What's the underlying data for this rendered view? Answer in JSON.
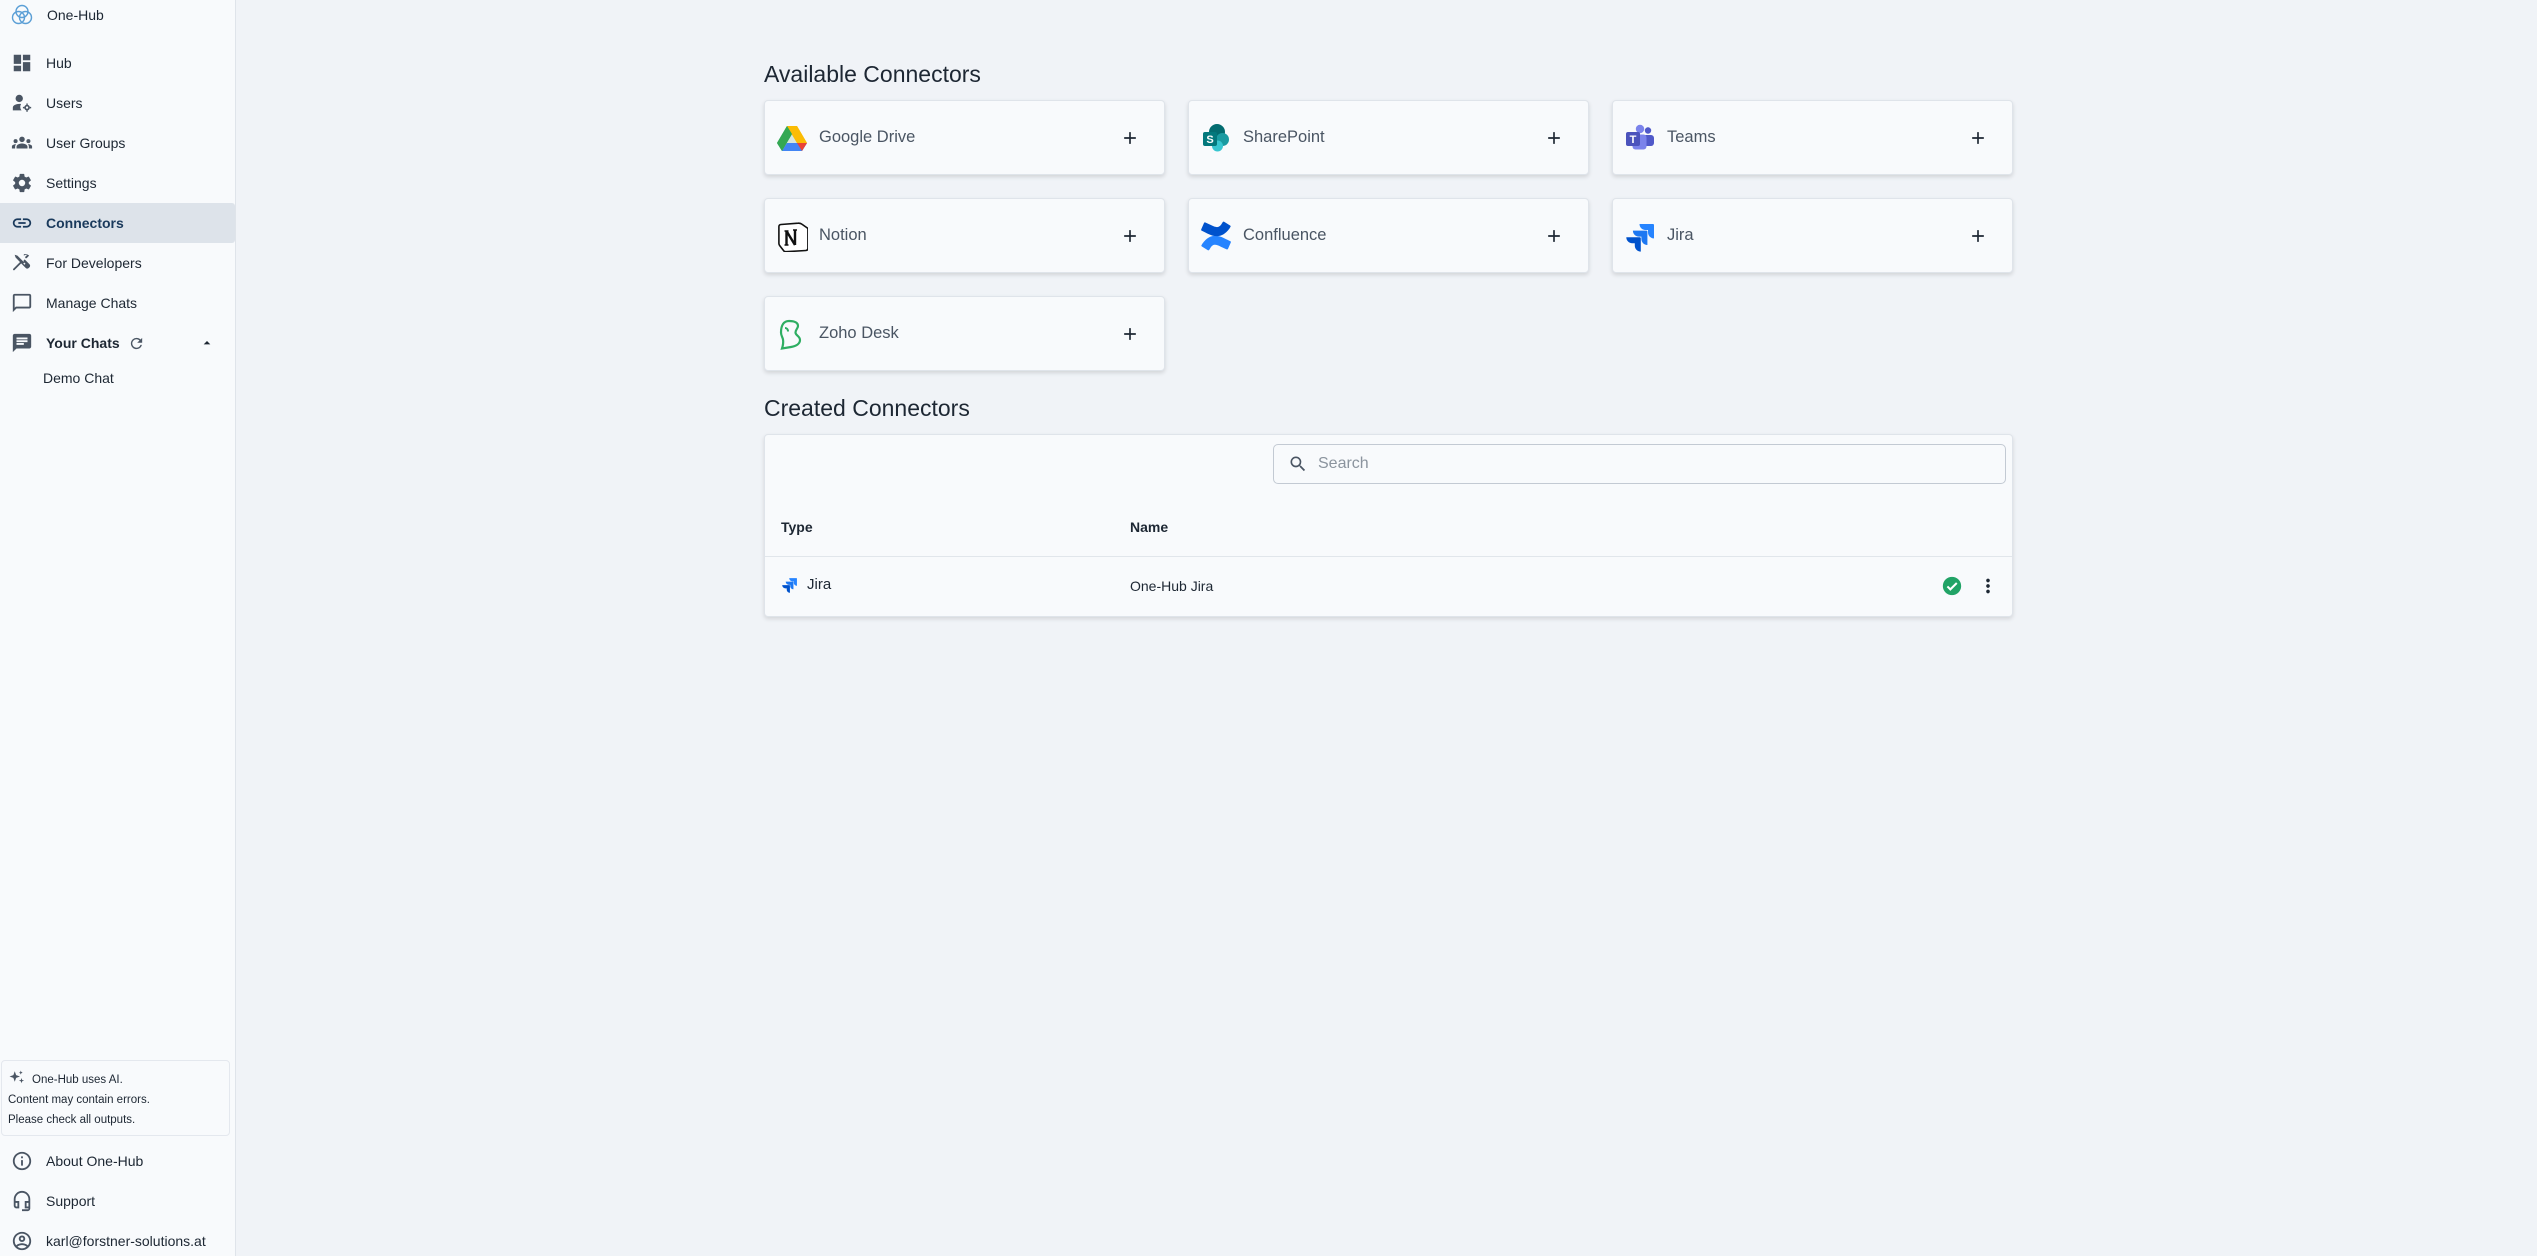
{
  "app": {
    "name": "One-Hub"
  },
  "sidebar": {
    "items": [
      {
        "label": "Hub",
        "icon": "dashboard-icon"
      },
      {
        "label": "Users",
        "icon": "user-settings-icon"
      },
      {
        "label": "User Groups",
        "icon": "groups-icon"
      },
      {
        "label": "Settings",
        "icon": "gear-icon"
      },
      {
        "label": "Connectors",
        "icon": "link-icon",
        "active": true
      },
      {
        "label": "For Developers",
        "icon": "developer-tools-icon"
      },
      {
        "label": "Manage Chats",
        "icon": "chat-bubble-icon"
      }
    ],
    "your_chats": {
      "label": "Your Chats",
      "chats": [
        "Demo Chat"
      ]
    },
    "notice": {
      "line1": "One-Hub uses AI.",
      "line2": "Content may contain errors.",
      "line3": "Please check all outputs."
    },
    "bottom": [
      {
        "label": "About One-Hub",
        "icon": "info-icon"
      },
      {
        "label": "Support",
        "icon": "headset-icon"
      },
      {
        "label": "karl@forstner-solutions.at",
        "icon": "account-icon"
      }
    ]
  },
  "available": {
    "title": "Available Connectors",
    "connectors": [
      {
        "name": "Google Drive",
        "icon": "google-drive-icon"
      },
      {
        "name": "SharePoint",
        "icon": "sharepoint-icon"
      },
      {
        "name": "Teams",
        "icon": "teams-icon"
      },
      {
        "name": "Notion",
        "icon": "notion-icon"
      },
      {
        "name": "Confluence",
        "icon": "confluence-icon"
      },
      {
        "name": "Jira",
        "icon": "jira-icon"
      },
      {
        "name": "Zoho Desk",
        "icon": "zoho-desk-icon"
      }
    ]
  },
  "created": {
    "title": "Created Connectors",
    "search_placeholder": "Search",
    "columns": {
      "type": "Type",
      "name": "Name"
    },
    "rows": [
      {
        "type": "Jira",
        "name": "One-Hub Jira",
        "status": "connected"
      }
    ]
  },
  "colors": {
    "background": "#f0f3f7",
    "sidebar": "#f8fafc",
    "active_nav": "#dde3ea",
    "status_ok": "#21a366",
    "jira_blue": "#2684ff"
  }
}
